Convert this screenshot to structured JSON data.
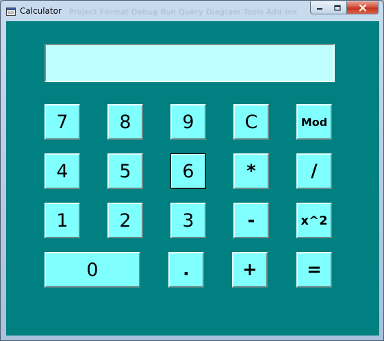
{
  "window": {
    "title": "Calculator",
    "ghost_menu": "Project   Format   Debug   Run   Query   Diagram   Tools   Add-Ins"
  },
  "display": {
    "value": ""
  },
  "keys": {
    "k7": "7",
    "k8": "8",
    "k9": "9",
    "clear": "C",
    "mod": "Mod",
    "k4": "4",
    "k5": "5",
    "k6": "6",
    "multiply": "*",
    "divide": "/",
    "k1": "1",
    "k2": "2",
    "k3": "3",
    "subtract": "-",
    "square": "x^2",
    "k0": "0",
    "decimal": ".",
    "add": "+",
    "equals": "="
  },
  "icons": {
    "app": "calculator-window-icon",
    "minimize": "minimize-icon",
    "maximize": "maximize-icon",
    "close": "close-icon"
  },
  "colors": {
    "client_bg": "#008080",
    "key_bg": "#80ffff",
    "display_bg": "#c0ffff"
  }
}
